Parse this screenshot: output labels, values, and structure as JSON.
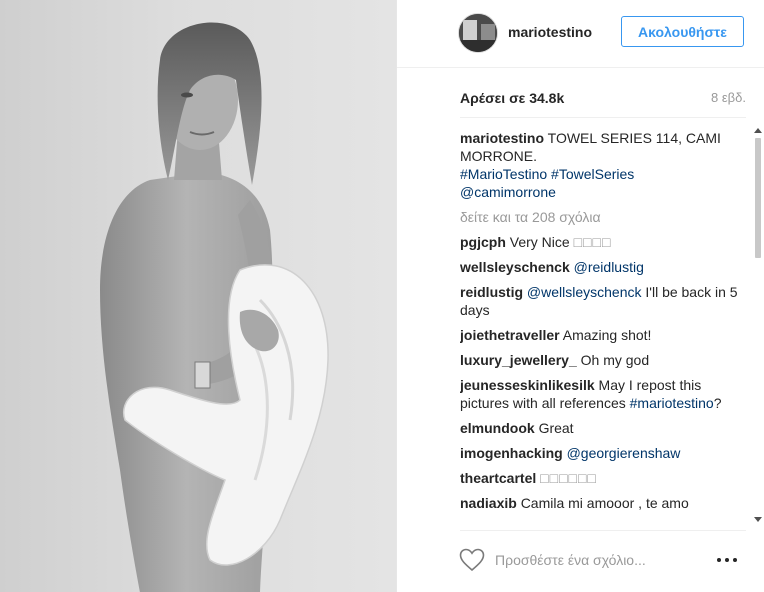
{
  "post": {
    "photo_alt": "TOWEL SERIES 114, CAMI MORRONE",
    "author": {
      "username": "mariotestino",
      "follow_label": "Ακολουθήστε"
    },
    "likes_label": "Αρέσει σε 34.8k",
    "time_ago": "8 εβδ.",
    "caption": {
      "username": "mariotestino",
      "text": "TOWEL SERIES 114, CAMI MORRONE.",
      "hashtags": [
        "#MarioTestino",
        "#TowelSeries"
      ],
      "mention": "@camimorrone"
    },
    "load_more_label": "δείτε και τα 208 σχόλια",
    "comments": [
      {
        "username": "pgjcph",
        "text": "Very Nice",
        "extra": "□□□□"
      },
      {
        "username": "wellsleyschenck",
        "mention": "@reidlustig",
        "text": ""
      },
      {
        "username": "reidlustig",
        "mention": "@wellsleyschenck",
        "text": "I'll be back in 5 days"
      },
      {
        "username": "joiethetraveller",
        "text": "Amazing shot!"
      },
      {
        "username": "luxury_jewellery_",
        "text": "Oh my god"
      },
      {
        "username": "jeunesseskinlikesilk",
        "text": "May I repost this pictures with all references",
        "mention": "#mariotestino",
        "suffix": "?"
      },
      {
        "username": "elmundook",
        "text": "Great"
      },
      {
        "username": "imogenhacking",
        "mention": "@georgierenshaw",
        "text": ""
      },
      {
        "username": "theartcartel",
        "extra": "□□□□□□"
      },
      {
        "username": "nadiaxib",
        "text": "Camila mi amooor , te amo"
      }
    ],
    "add_comment_placeholder": "Προσθέστε ένα σχόλιο...",
    "icons": {
      "like": "heart-icon",
      "more": "more-options-icon"
    },
    "colors": {
      "link": "#003569",
      "follow": "#3897f0",
      "muted": "#999999"
    }
  }
}
